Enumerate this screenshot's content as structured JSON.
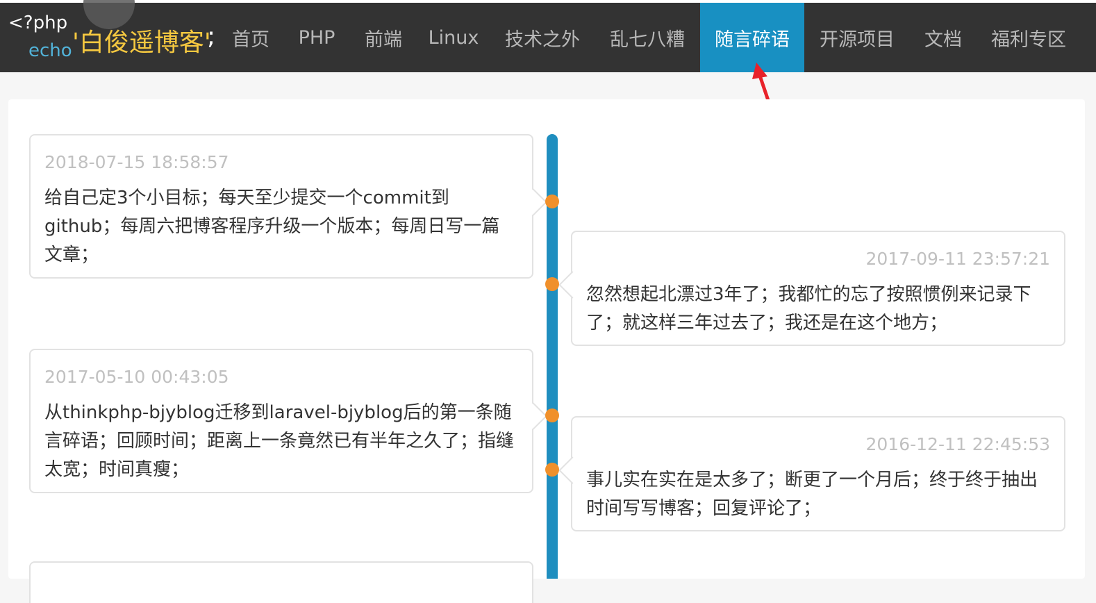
{
  "header": {
    "logo_php": "<?php",
    "logo_echo": "echo",
    "logo_name": "'白俊遥博客'",
    "logo_semicolon": ";",
    "nav": [
      {
        "label": "首页"
      },
      {
        "label": "PHP"
      },
      {
        "label": "前端"
      },
      {
        "label": "Linux"
      },
      {
        "label": "技术之外"
      },
      {
        "label": "乱七八糟"
      },
      {
        "label": "随言碎语",
        "active": true
      },
      {
        "label": "开源项目"
      },
      {
        "label": "文档"
      },
      {
        "label": "福利专区"
      }
    ]
  },
  "colors": {
    "nav_bg": "#333333",
    "active_tab": "#1890c2",
    "timeline": "#1f8ebf",
    "dot": "#f0902b",
    "logo_name": "#f5c840",
    "logo_echo": "#52b3d9",
    "annotation_arrow": "#e8222a"
  },
  "entries": [
    {
      "time": "2018-07-15 18:58:57",
      "text": "给自己定3个小目标；每天至少提交一个commit到github；每周六把博客程序升级一个版本；每周日写一篇文章；"
    },
    {
      "time": "2017-09-11 23:57:21",
      "text": "忽然想起北漂过3年了；我都忙的忘了按照惯例来记录下了；就这样三年过去了；我还是在这个地方；"
    },
    {
      "time": "2017-05-10 00:43:05",
      "text": "从thinkphp-bjyblog迁移到laravel-bjyblog后的第一条随言碎语；回顾时间；距离上一条竟然已有半年之久了；指缝太宽；时间真瘦；"
    },
    {
      "time": "2016-12-11 22:45:53",
      "text": "事儿实在实在是太多了；断更了一个月后；终于终于抽出时间写写博客；回复评论了；"
    }
  ]
}
